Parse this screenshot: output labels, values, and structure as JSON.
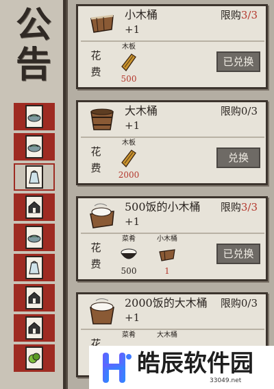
{
  "sidebar": {
    "title_chars": [
      "公",
      "告"
    ],
    "icons": [
      "fish-plate-icon",
      "fish-plate-icon",
      "bag-icon",
      "house-icon",
      "fish-plate-icon",
      "bag-icon",
      "house-icon",
      "house-icon",
      "vegetable-icon"
    ]
  },
  "cost_label_chars": [
    "花",
    "费"
  ],
  "cards": [
    {
      "item_icon": "small-wooden-bucket-icon",
      "title": "小木桶",
      "qty": "+1",
      "limit_prefix": "限购",
      "limit_value": "3/3",
      "limit_full": true,
      "button_label": "已兑换",
      "materials": [
        {
          "name": "木板",
          "icon": "wood-plank-icon",
          "count": "500",
          "count_red": true
        }
      ]
    },
    {
      "item_icon": "large-wooden-bucket-icon",
      "title": "大木桶",
      "qty": "+1",
      "limit_prefix": "限购",
      "limit_value": "0/3",
      "limit_full": false,
      "button_label": "兑换",
      "materials": [
        {
          "name": "木板",
          "icon": "wood-plank-icon",
          "count": "2000",
          "count_red": true
        }
      ]
    },
    {
      "item_icon": "rice-small-bucket-icon",
      "title": "500饭的小木桶",
      "qty": "+1",
      "limit_prefix": "限购",
      "limit_value": "3/3",
      "limit_full": true,
      "button_label": "已兑换",
      "materials": [
        {
          "name": "菜肴",
          "icon": "rice-bowl-icon",
          "count": "500",
          "count_red": false
        },
        {
          "name": "小木桶",
          "icon": "small-wooden-bucket-icon",
          "count": "1",
          "count_red": true
        }
      ]
    },
    {
      "item_icon": "rice-large-bucket-icon",
      "title": "2000饭的大木桶",
      "qty": "+1",
      "limit_prefix": "限购",
      "limit_value": "0/3",
      "limit_full": false,
      "button_label": "",
      "materials": [
        {
          "name": "菜肴",
          "icon": "rice-bowl-icon",
          "count": "",
          "count_red": false
        },
        {
          "name": "大木桶",
          "icon": "large-wooden-bucket-icon",
          "count": "",
          "count_red": false
        }
      ]
    }
  ],
  "watermark": {
    "text": "皓辰软件园",
    "url": "33049.net"
  }
}
